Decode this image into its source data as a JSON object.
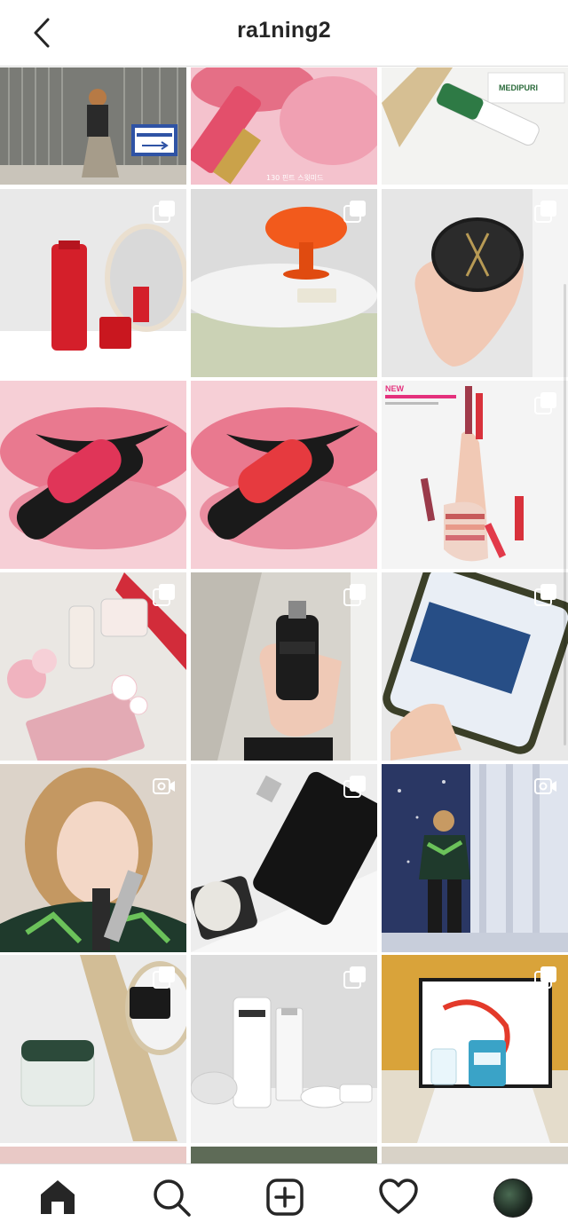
{
  "header": {
    "username": "ra1ning2",
    "back_icon": "chevron-left-icon"
  },
  "posts": [
    {
      "id": "p1",
      "badge": "none",
      "tone": [
        "#8b8c86",
        "#5a5852"
      ]
    },
    {
      "id": "p2",
      "badge": "none",
      "tone": [
        "#f3b6c2",
        "#e05a73"
      ],
      "caption": "130 핀트 스윗미드"
    },
    {
      "id": "p3",
      "badge": "none",
      "tone": [
        "#f1f1ef",
        "#d9c6a0"
      ],
      "brand_label": "MEDIPURI"
    },
    {
      "id": "p4",
      "badge": "carousel",
      "tone": [
        "#e8e8e8",
        "#d41f2a"
      ]
    },
    {
      "id": "p5",
      "badge": "carousel",
      "tone": [
        "#e6e6e6",
        "#f25a1c"
      ]
    },
    {
      "id": "p6",
      "badge": "carousel",
      "tone": [
        "#e2e2e2",
        "#1c1c1c"
      ]
    },
    {
      "id": "p7",
      "badge": "none",
      "tone": [
        "#f3c7cf",
        "#e2415e"
      ]
    },
    {
      "id": "p8",
      "badge": "none",
      "tone": [
        "#f3c7cf",
        "#e2415e"
      ]
    },
    {
      "id": "p9",
      "badge": "carousel",
      "tone": [
        "#f2f2f2",
        "#c23a3f"
      ],
      "corner_text": "NEW"
    },
    {
      "id": "p10",
      "badge": "carousel",
      "tone": [
        "#f0eaea",
        "#d64a6a"
      ]
    },
    {
      "id": "p11",
      "badge": "carousel",
      "tone": [
        "#d9d5cd",
        "#2a2a2a"
      ]
    },
    {
      "id": "p12",
      "badge": "carousel",
      "tone": [
        "#e8e8e8",
        "#1a4f8a"
      ]
    },
    {
      "id": "p13",
      "badge": "video",
      "tone": [
        "#d9cfc4",
        "#b8895a"
      ]
    },
    {
      "id": "p14",
      "badge": "carousel",
      "tone": [
        "#ececec",
        "#151515"
      ]
    },
    {
      "id": "p15",
      "badge": "video",
      "tone": [
        "#2b3560",
        "#e6e9ef"
      ]
    },
    {
      "id": "p16",
      "badge": "carousel",
      "tone": [
        "#ececec",
        "#2c4a3a"
      ]
    },
    {
      "id": "p17",
      "badge": "carousel",
      "tone": [
        "#f2f2f2",
        "#ffffff"
      ]
    },
    {
      "id": "p18",
      "badge": "carousel",
      "tone": [
        "#e9e2d2",
        "#3aa3c7"
      ]
    }
  ],
  "nav": {
    "items": [
      {
        "name": "home-icon",
        "active": true
      },
      {
        "name": "search-icon",
        "active": false
      },
      {
        "name": "new-post-icon",
        "active": false
      },
      {
        "name": "activity-heart-icon",
        "active": false
      },
      {
        "name": "profile-avatar",
        "active": false
      }
    ]
  }
}
